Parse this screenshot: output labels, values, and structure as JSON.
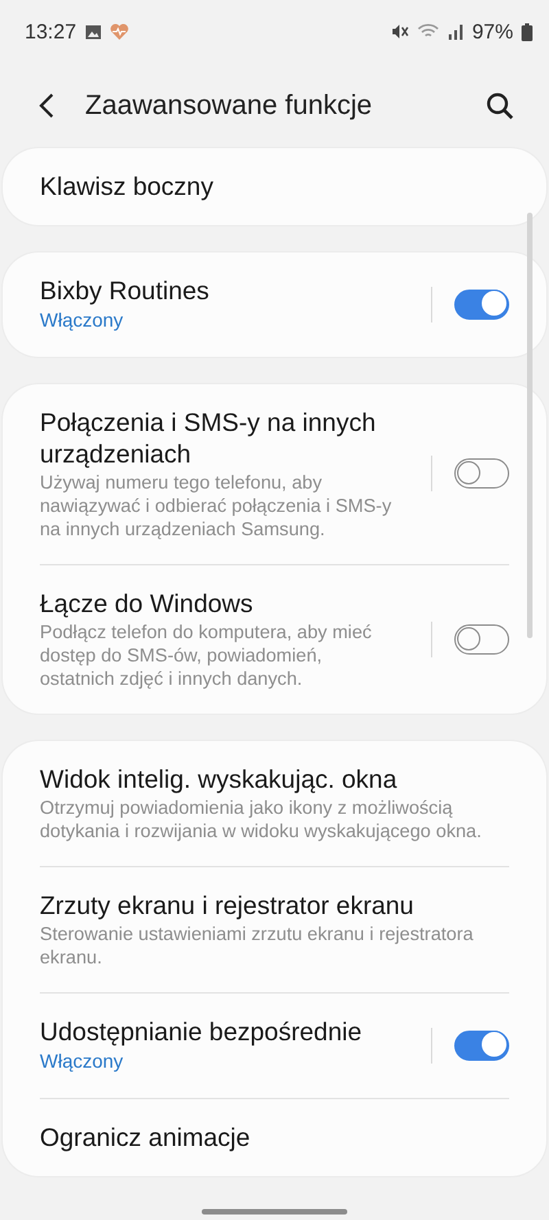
{
  "status_bar": {
    "time": "13:27",
    "battery": "97%"
  },
  "header": {
    "title": "Zaawansowane funkcje"
  },
  "groups": [
    {
      "items": [
        {
          "kind": "link",
          "title": "Klawisz boczny"
        }
      ]
    },
    {
      "items": [
        {
          "kind": "switch",
          "title": "Bixby Routines",
          "status": "Włączony",
          "on": true
        }
      ]
    },
    {
      "items": [
        {
          "kind": "switch",
          "title": "Połączenia i SMS-y na innych urządzeniach",
          "subtitle": "Używaj numeru tego telefonu, aby nawiązywać i odbierać połączenia i SMS-y na innych urządzeniach Samsung.",
          "on": false
        },
        {
          "kind": "switch",
          "title": "Łącze do Windows",
          "subtitle": "Podłącz telefon do komputera, aby mieć dostęp do SMS-ów, powiadomień, ostatnich zdjęć i innych danych.",
          "on": false
        }
      ]
    },
    {
      "items": [
        {
          "kind": "link",
          "title": "Widok intelig. wyskakując. okna",
          "subtitle": "Otrzymuj powiadomienia jako ikony z możliwością dotykania i rozwijania w widoku wyskakującego okna."
        },
        {
          "kind": "link",
          "title": "Zrzuty ekranu i rejestrator ekranu",
          "subtitle": "Sterowanie ustawieniami zrzutu ekranu i rejestratora ekranu."
        },
        {
          "kind": "switch",
          "title": "Udostępnianie bezpośrednie",
          "status": "Włączony",
          "on": true
        },
        {
          "kind": "link",
          "title": "Ogranicz animacje"
        }
      ]
    }
  ]
}
